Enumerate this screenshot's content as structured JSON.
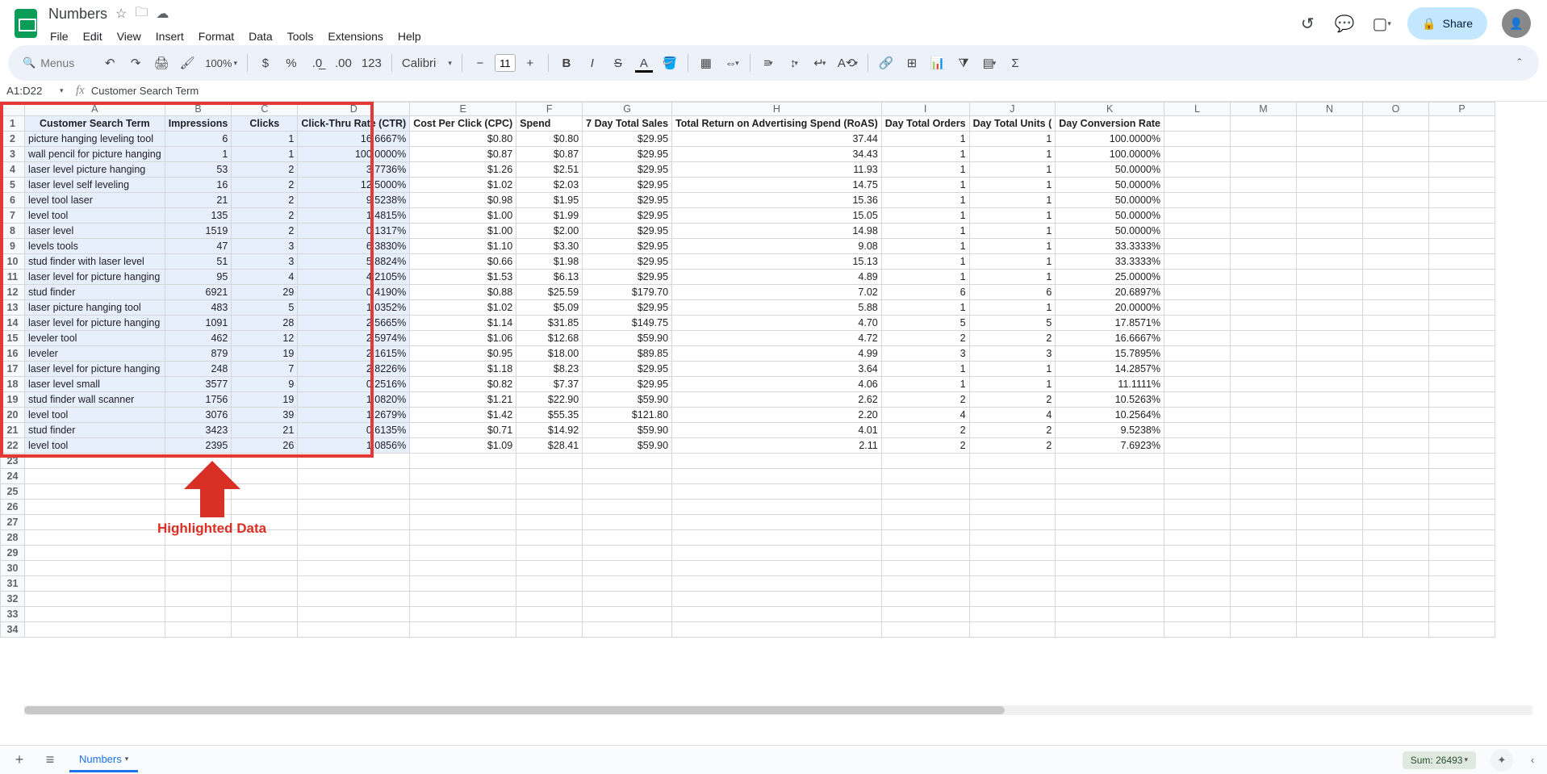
{
  "doc_title": "Numbers",
  "menu": [
    "File",
    "Edit",
    "View",
    "Insert",
    "Format",
    "Data",
    "Tools",
    "Extensions",
    "Help"
  ],
  "search_placeholder": "Menus",
  "zoom": "100%",
  "font_name": "Calibri",
  "font_size": "11",
  "namebox": "A1:D22",
  "formula_value": "Customer Search Term",
  "share_label": "Share",
  "columns": [
    "A",
    "B",
    "C",
    "D",
    "E",
    "F",
    "G",
    "H",
    "I",
    "J",
    "K",
    "L",
    "M",
    "N",
    "O",
    "P"
  ],
  "headers": {
    "A": "Customer Search Term",
    "B": "Impressions",
    "C": "Clicks",
    "D": "Click-Thru Rate (CTR)",
    "E": "Cost Per Click (CPC)",
    "F": "Spend",
    "G": "7 Day Total Sales",
    "H": "Total Return on Advertising Spend (RoAS)",
    "I": "Day Total Orders",
    "J": "Day Total Units (",
    "K": "Day Conversion Rate"
  },
  "rows": [
    {
      "A": "picture hanging leveling tool",
      "B": "6",
      "C": "1",
      "D": "16.6667%",
      "E": "$0.80",
      "F": "$0.80",
      "G": "$29.95",
      "H": "37.44",
      "I": "1",
      "J": "1",
      "K": "100.0000%"
    },
    {
      "A": "wall pencil for picture hanging",
      "B": "1",
      "C": "1",
      "D": "100.0000%",
      "E": "$0.87",
      "F": "$0.87",
      "G": "$29.95",
      "H": "34.43",
      "I": "1",
      "J": "1",
      "K": "100.0000%"
    },
    {
      "A": "laser level picture hanging",
      "B": "53",
      "C": "2",
      "D": "3.7736%",
      "E": "$1.26",
      "F": "$2.51",
      "G": "$29.95",
      "H": "11.93",
      "I": "1",
      "J": "1",
      "K": "50.0000%"
    },
    {
      "A": "laser level self leveling",
      "B": "16",
      "C": "2",
      "D": "12.5000%",
      "E": "$1.02",
      "F": "$2.03",
      "G": "$29.95",
      "H": "14.75",
      "I": "1",
      "J": "1",
      "K": "50.0000%"
    },
    {
      "A": "level tool laser",
      "B": "21",
      "C": "2",
      "D": "9.5238%",
      "E": "$0.98",
      "F": "$1.95",
      "G": "$29.95",
      "H": "15.36",
      "I": "1",
      "J": "1",
      "K": "50.0000%"
    },
    {
      "A": "level tool",
      "B": "135",
      "C": "2",
      "D": "1.4815%",
      "E": "$1.00",
      "F": "$1.99",
      "G": "$29.95",
      "H": "15.05",
      "I": "1",
      "J": "1",
      "K": "50.0000%"
    },
    {
      "A": "laser level",
      "B": "1519",
      "C": "2",
      "D": "0.1317%",
      "E": "$1.00",
      "F": "$2.00",
      "G": "$29.95",
      "H": "14.98",
      "I": "1",
      "J": "1",
      "K": "50.0000%"
    },
    {
      "A": "levels tools",
      "B": "47",
      "C": "3",
      "D": "6.3830%",
      "E": "$1.10",
      "F": "$3.30",
      "G": "$29.95",
      "H": "9.08",
      "I": "1",
      "J": "1",
      "K": "33.3333%"
    },
    {
      "A": "stud finder with laser level",
      "B": "51",
      "C": "3",
      "D": "5.8824%",
      "E": "$0.66",
      "F": "$1.98",
      "G": "$29.95",
      "H": "15.13",
      "I": "1",
      "J": "1",
      "K": "33.3333%"
    },
    {
      "A": "laser level for picture hanging",
      "B": "95",
      "C": "4",
      "D": "4.2105%",
      "E": "$1.53",
      "F": "$6.13",
      "G": "$29.95",
      "H": "4.89",
      "I": "1",
      "J": "1",
      "K": "25.0000%"
    },
    {
      "A": "stud finder",
      "B": "6921",
      "C": "29",
      "D": "0.4190%",
      "E": "$0.88",
      "F": "$25.59",
      "G": "$179.70",
      "H": "7.02",
      "I": "6",
      "J": "6",
      "K": "20.6897%"
    },
    {
      "A": "laser picture hanging tool",
      "B": "483",
      "C": "5",
      "D": "1.0352%",
      "E": "$1.02",
      "F": "$5.09",
      "G": "$29.95",
      "H": "5.88",
      "I": "1",
      "J": "1",
      "K": "20.0000%"
    },
    {
      "A": "laser level for picture hanging",
      "B": "1091",
      "C": "28",
      "D": "2.5665%",
      "E": "$1.14",
      "F": "$31.85",
      "G": "$149.75",
      "H": "4.70",
      "I": "5",
      "J": "5",
      "K": "17.8571%"
    },
    {
      "A": "leveler tool",
      "B": "462",
      "C": "12",
      "D": "2.5974%",
      "E": "$1.06",
      "F": "$12.68",
      "G": "$59.90",
      "H": "4.72",
      "I": "2",
      "J": "2",
      "K": "16.6667%"
    },
    {
      "A": "leveler",
      "B": "879",
      "C": "19",
      "D": "2.1615%",
      "E": "$0.95",
      "F": "$18.00",
      "G": "$89.85",
      "H": "4.99",
      "I": "3",
      "J": "3",
      "K": "15.7895%"
    },
    {
      "A": "laser level for picture hanging",
      "B": "248",
      "C": "7",
      "D": "2.8226%",
      "E": "$1.18",
      "F": "$8.23",
      "G": "$29.95",
      "H": "3.64",
      "I": "1",
      "J": "1",
      "K": "14.2857%"
    },
    {
      "A": "laser level small",
      "B": "3577",
      "C": "9",
      "D": "0.2516%",
      "E": "$0.82",
      "F": "$7.37",
      "G": "$29.95",
      "H": "4.06",
      "I": "1",
      "J": "1",
      "K": "11.1111%"
    },
    {
      "A": "stud finder wall scanner",
      "B": "1756",
      "C": "19",
      "D": "1.0820%",
      "E": "$1.21",
      "F": "$22.90",
      "G": "$59.90",
      "H": "2.62",
      "I": "2",
      "J": "2",
      "K": "10.5263%"
    },
    {
      "A": "level tool",
      "B": "3076",
      "C": "39",
      "D": "1.2679%",
      "E": "$1.42",
      "F": "$55.35",
      "G": "$121.80",
      "H": "2.20",
      "I": "4",
      "J": "4",
      "K": "10.2564%"
    },
    {
      "A": "stud finder",
      "B": "3423",
      "C": "21",
      "D": "0.6135%",
      "E": "$0.71",
      "F": "$14.92",
      "G": "$59.90",
      "H": "4.01",
      "I": "2",
      "J": "2",
      "K": "9.5238%"
    },
    {
      "A": "level tool",
      "B": "2395",
      "C": "26",
      "D": "1.0856%",
      "E": "$1.09",
      "F": "$28.41",
      "G": "$59.90",
      "H": "2.11",
      "I": "2",
      "J": "2",
      "K": "7.6923%"
    }
  ],
  "empty_rows": [
    23,
    24,
    25,
    26,
    27,
    28,
    29,
    30,
    31,
    32,
    33,
    34
  ],
  "annotation_label": "Highlighted Data",
  "sheet_tab": "Numbers",
  "status_sum": "Sum: 26493"
}
